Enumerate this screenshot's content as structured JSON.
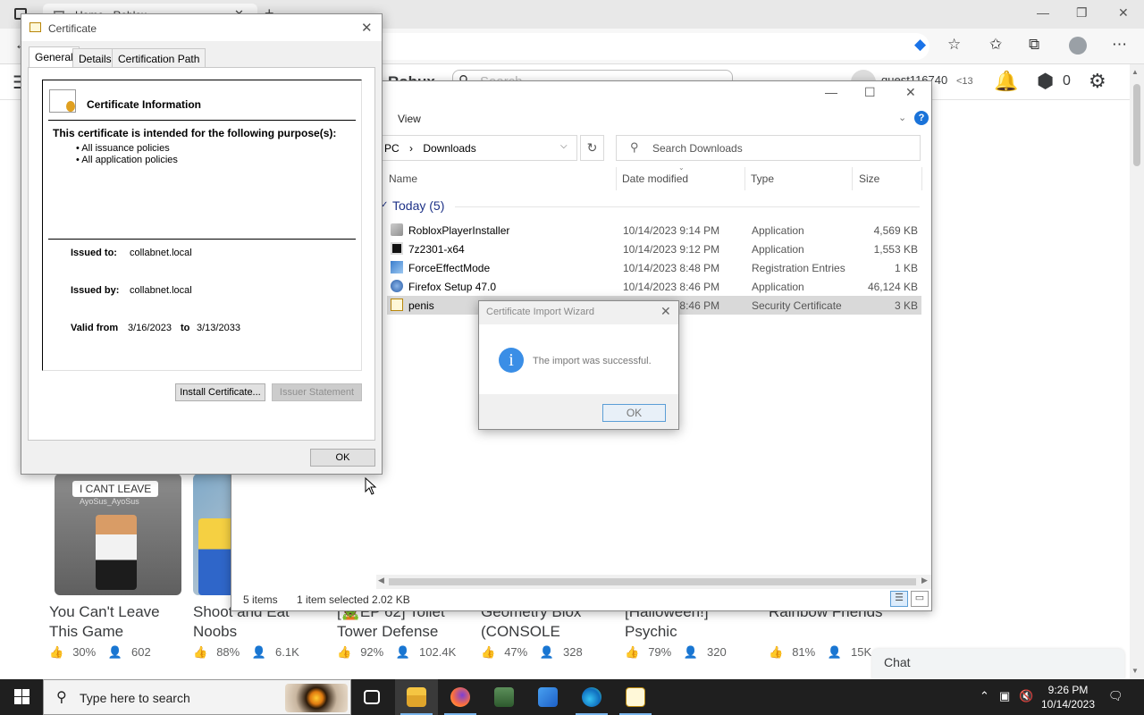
{
  "browser": {
    "tab_title": "Home - Roblox",
    "address_tail": "e",
    "icons": [
      "tag-icon",
      "add-favorite-icon",
      "favorites-icon",
      "collections-icon",
      "profile-icon",
      "more-icon"
    ]
  },
  "roblox": {
    "menu_icon": "hamburger-icon",
    "robux_label": "Robux",
    "search_placeholder": "Search",
    "username": "guest116740",
    "age_badge": "<13",
    "robux_count": "0",
    "chat_label": "Chat",
    "games": [
      {
        "title": "You Can't Leave This Game",
        "thumb_text": "I CANT LEAVE",
        "thumb_sub": "AyoSus_AyoSus",
        "rating": "30%",
        "players": "602"
      },
      {
        "title": "Shoot and Eat Noobs",
        "rating": "88%",
        "players": "6.1K"
      },
      {
        "title": "[🧟EP 62] Toilet Tower Defense",
        "rating": "92%",
        "players": "102.4K"
      },
      {
        "title": "Geometry Blox (CONSOLE",
        "rating": "47%",
        "players": "328"
      },
      {
        "title": "[Halloween!] Psychic",
        "rating": "79%",
        "players": "320"
      },
      {
        "title": "Rainbow Friends",
        "rating": "81%",
        "players": "15K"
      }
    ]
  },
  "explorer": {
    "ribbon_view": "View",
    "path_prefix": "PC",
    "path_sep": "›",
    "path_current": "Downloads",
    "search_placeholder": "Search Downloads",
    "columns": {
      "name": "Name",
      "date": "Date modified",
      "type": "Type",
      "size": "Size"
    },
    "group_label": "Today (5)",
    "files": [
      {
        "name": "RobloxPlayerInstaller",
        "date": "10/14/2023 9:14 PM",
        "type": "Application",
        "size": "4,569 KB",
        "icon": "installer-icon"
      },
      {
        "name": "7z2301-x64",
        "date": "10/14/2023 9:12 PM",
        "type": "Application",
        "size": "1,553 KB",
        "icon": "7zip-icon"
      },
      {
        "name": "ForceEffectMode",
        "date": "10/14/2023 8:48 PM",
        "type": "Registration Entries",
        "size": "1 KB",
        "icon": "registry-icon"
      },
      {
        "name": "Firefox Setup 47.0",
        "date": "10/14/2023 8:46 PM",
        "type": "Application",
        "size": "46,124 KB",
        "icon": "firefox-setup-icon"
      },
      {
        "name": "penis",
        "date": "10/14/2023 8:46 PM",
        "type": "Security Certificate",
        "size": "3 KB",
        "icon": "certificate-icon"
      }
    ],
    "status_items": "5 items",
    "status_selected": "1 item selected  2.02 KB"
  },
  "wizard": {
    "title": "Certificate Import Wizard",
    "message": "The import was successful.",
    "ok_label": "OK"
  },
  "certificate": {
    "title": "Certificate",
    "tabs": [
      "General",
      "Details",
      "Certification Path"
    ],
    "info_title": "Certificate Information",
    "purpose_heading": "This certificate is intended for the following purpose(s):",
    "purposes": [
      "• All issuance policies",
      "• All application policies"
    ],
    "issued_to_label": "Issued to:",
    "issued_to": "collabnet.local",
    "issued_by_label": "Issued by:",
    "issued_by": "collabnet.local",
    "valid_from_label": "Valid from",
    "valid_from": "3/16/2023",
    "to_label": "to",
    "valid_to": "3/13/2033",
    "install_label": "Install Certificate...",
    "issuer_statement_label": "Issuer Statement",
    "ok_label": "OK"
  },
  "taskbar": {
    "search_placeholder": "Type here to search",
    "time": "9:26 PM",
    "date": "10/14/2023"
  }
}
